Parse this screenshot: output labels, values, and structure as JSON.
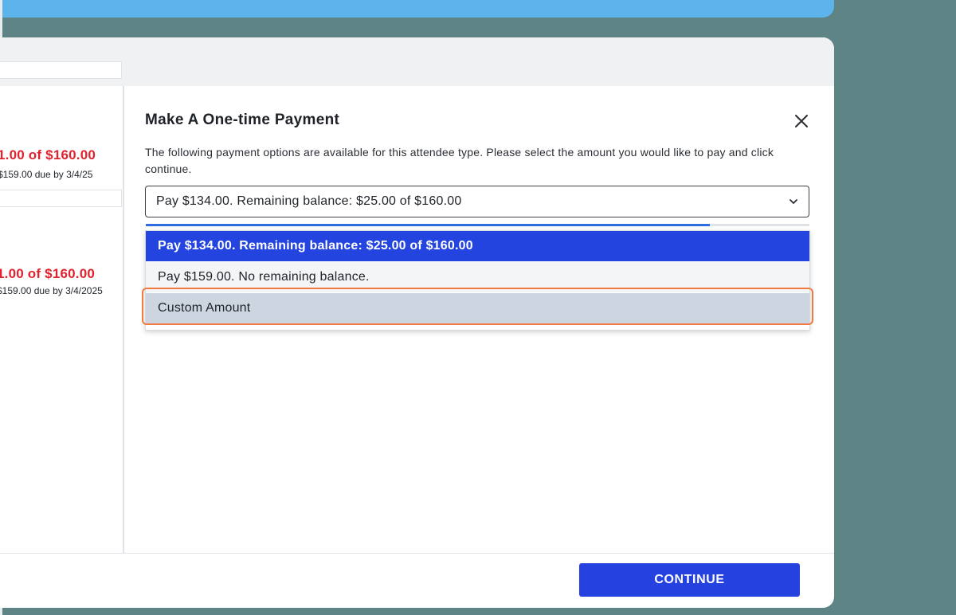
{
  "background_items": [
    {
      "amount": "1.00 of $160.00",
      "due": "$159.00 due by 3/4/25"
    },
    {
      "amount": "1.00 of $160.00",
      "due": "$159.00 due by 3/4/2025"
    }
  ],
  "modal": {
    "title": "Make A One-time Payment",
    "description": "The following payment options are available for this attendee type. Please select the amount you would like to pay and click continue.",
    "select_value": "Pay $134.00. Remaining balance: $25.00 of $160.00",
    "options": [
      {
        "label": "Pay $134.00. Remaining balance: $25.00 of $160.00",
        "selected": true
      },
      {
        "label": "Pay $159.00. No remaining balance.",
        "selected": false
      },
      {
        "label": "Custom Amount",
        "selected": false
      }
    ],
    "progress": 0.85,
    "continue_label": "CONTINUE"
  },
  "icons": {
    "close": "close-icon",
    "dropdown": "chevron-down-icon"
  },
  "colors": {
    "accent": "#2541e0",
    "amount_red": "#e0222e",
    "highlight": "#f07a3f"
  }
}
